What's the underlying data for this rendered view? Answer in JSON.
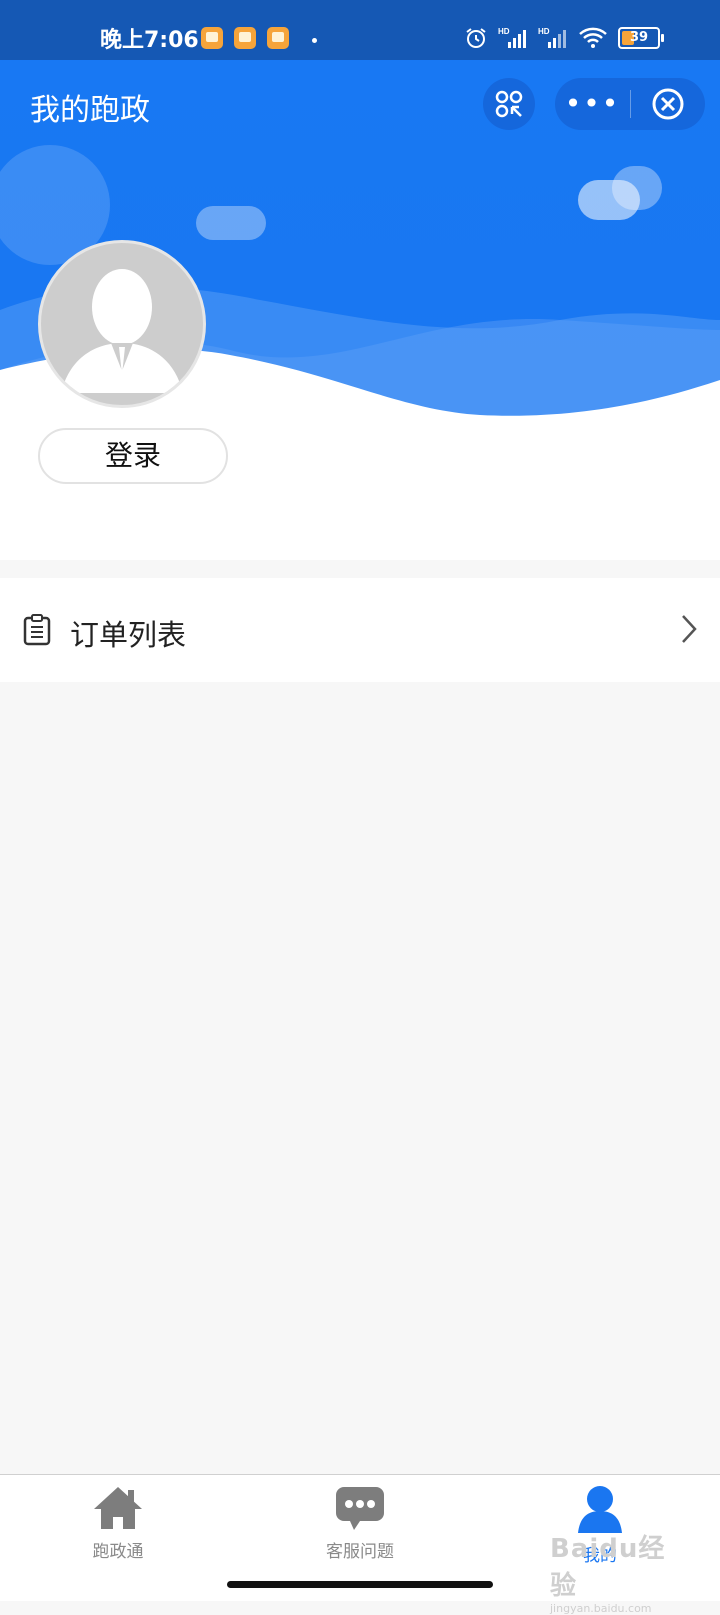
{
  "status_bar": {
    "time": "晚上7:06",
    "battery": "39",
    "network": "HD"
  },
  "header": {
    "title": "我的跑政",
    "capsule_more_icon": "more-dots-icon",
    "capsule_close_icon": "close-circle-icon",
    "scan_icon": "scan-icon"
  },
  "profile": {
    "avatar_icon": "default-avatar-icon",
    "login_label": "登录"
  },
  "menu": {
    "items": [
      {
        "label": "订单列表",
        "icon": "clipboard-icon"
      }
    ]
  },
  "tabbar": {
    "items": [
      {
        "label": "跑政通",
        "icon": "home-icon",
        "active": false
      },
      {
        "label": "客服问题",
        "icon": "chat-icon",
        "active": false
      },
      {
        "label": "我的",
        "icon": "user-icon",
        "active": true
      }
    ],
    "active_color": "#1a76f0",
    "inactive_color": "#8a8a8a"
  },
  "watermark": {
    "text": "Baidu经验",
    "sub": "jingyan.baidu.com"
  },
  "colors": {
    "header_blue": "#1878f3",
    "status_bar": "#1558b4",
    "page_bg": "#f7f7f7"
  }
}
